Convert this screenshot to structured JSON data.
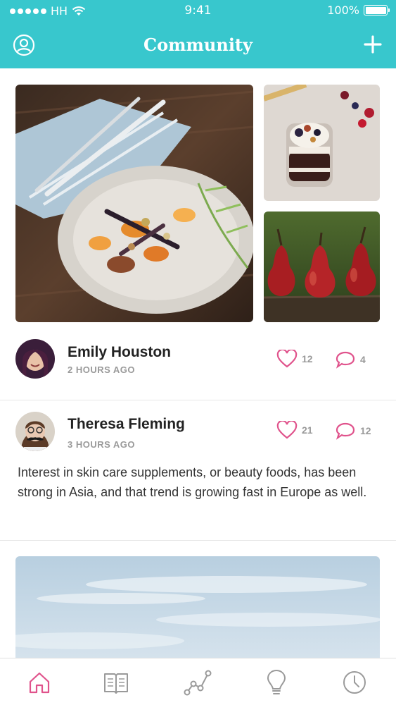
{
  "status_bar": {
    "carrier": "HH",
    "time": "9:41",
    "battery": "100%"
  },
  "header": {
    "title": "Community",
    "left_icon": "profile-icon",
    "right_icon": "plus-icon",
    "color": "#38c7cd"
  },
  "posts": [
    {
      "author": "Emily Houston",
      "time_ago": "2 HOURS AGO",
      "likes": "12",
      "comments": "4",
      "photos": [
        "food-plate-photo",
        "parfait-photo",
        "pears-photo"
      ]
    },
    {
      "author": "Theresa Fleming",
      "time_ago": "3 HOURS AGO",
      "likes": "21",
      "comments": "12",
      "text": "Interest in skin care supplements, or beauty foods, has been strong in Asia, and that trend is growing fast in Europe as well."
    }
  ],
  "tabbar": {
    "items": [
      "home-icon",
      "book-icon",
      "chart-icon",
      "lightbulb-icon",
      "clock-icon"
    ],
    "active": "home-icon",
    "active_color": "#e0538c",
    "inactive_color": "#9a9a9a"
  },
  "colors": {
    "accent": "#e0538c",
    "header": "#38c7cd"
  }
}
